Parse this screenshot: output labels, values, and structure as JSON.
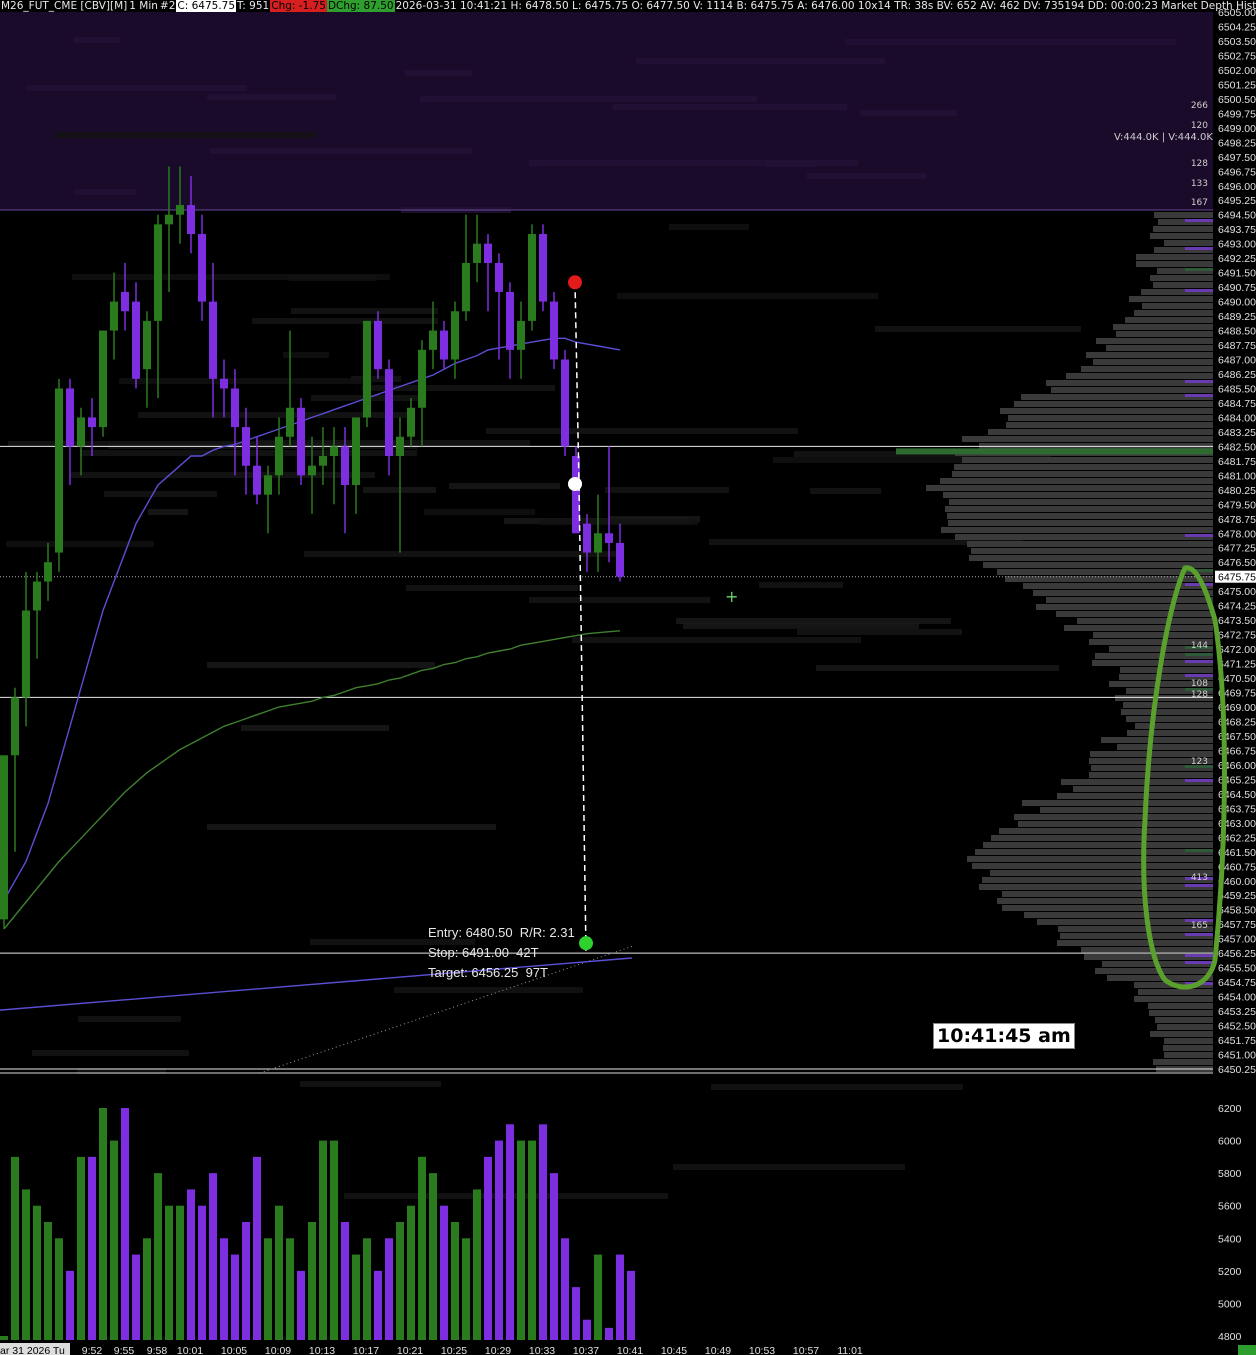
{
  "header": {
    "symbol": "M26_FUT_CME [CBV][M]",
    "interval": "1 Min",
    "chart_no": "#2",
    "close": "C: 6475.75",
    "ticks": "T: 951",
    "chg": "Chg: -1.75",
    "dchg": "DChg: 87.50",
    "rest": "2026-03-31 10:41:21 H: 6478.50 L: 6475.75 O: 6477.50 V: 1114 B: 6475.75 A: 6476.00 10x14 TR: 38s BV: 652 AV: 462 DV: 735194 DD: 00:00:23 Market Depth Historical G",
    "colors": {
      "chg_bg": "#d62020",
      "dchg_bg": "#2e9e2e",
      "close_bg": "#ffffff"
    }
  },
  "volume_readout": "V:444.0K | V:444.0K",
  "clock": "10:41:45 am",
  "trade": {
    "entry": "Entry: 6480.50  R/R: 2.31",
    "stop": "Stop: 6491.00  42T",
    "target": "Target: 6456.25  97T"
  },
  "price_axis": {
    "labels": [
      "6505.00",
      "6504.25",
      "6503.50",
      "6502.75",
      "6502.00",
      "6501.25",
      "6500.50",
      "6499.75",
      "6499.00",
      "6498.25",
      "6497.50",
      "6496.75",
      "6496.00",
      "6495.25",
      "6494.50",
      "6493.75",
      "6493.00",
      "6492.25",
      "6491.50",
      "6490.75",
      "6490.00",
      "6489.25",
      "6488.50",
      "6487.75",
      "6487.00",
      "6486.25",
      "6485.50",
      "6484.75",
      "6484.00",
      "6483.25",
      "6482.50",
      "6481.75",
      "6481.00",
      "6480.25",
      "6479.50",
      "6478.75",
      "6478.00",
      "6477.25",
      "6476.50",
      "6475.75",
      "6475.00",
      "6474.25",
      "6473.50",
      "6472.75",
      "6472.00",
      "6471.25",
      "6470.50",
      "6469.75",
      "6469.00",
      "6468.25",
      "6467.50",
      "6466.75",
      "6466.00",
      "6465.25",
      "6464.50",
      "6463.75",
      "6463.00",
      "6462.25",
      "6461.50",
      "6460.75",
      "6460.00",
      "6459.25",
      "6458.50",
      "6457.75",
      "6457.00",
      "6456.25",
      "6455.50",
      "6454.75",
      "6454.00",
      "6453.25",
      "6452.50",
      "6451.75",
      "6451.00",
      "6450.25"
    ],
    "current": "6475.75"
  },
  "volume_axis": {
    "labels": [
      "6200",
      "6000",
      "5800",
      "5600",
      "5400",
      "5200",
      "5000",
      "4800"
    ]
  },
  "time_axis": {
    "labels": [
      "ar 31 2026 Tu",
      "9:52",
      "9:55",
      "9:58",
      "10:01",
      "10:05",
      "10:09",
      "10:13",
      "10:17",
      "10:21",
      "10:25",
      "10:29",
      "10:33",
      "10:37",
      "10:41",
      "10:45",
      "10:49",
      "10:53",
      "10:57",
      "11:01"
    ]
  },
  "profile_labels": [
    "266",
    "120",
    "128",
    "133",
    "167",
    "144",
    "108",
    "128",
    "123",
    "413",
    "165"
  ],
  "chart_data": {
    "type": "candlestick",
    "title": "",
    "ylim": [
      6450.25,
      6505.0
    ],
    "volume_ylim": [
      4800,
      6200
    ],
    "colors": {
      "up": "#2a7a1e",
      "down": "#7c2ee0",
      "ma_fast": "#5b4fd6",
      "ma_slow": "#3f7f2f",
      "background": "#000000"
    },
    "candles": [
      {
        "o": 6458.0,
        "h": 6466.0,
        "l": 6457.5,
        "c": 6466.5
      },
      {
        "o": 6466.5,
        "h": 6470.0,
        "l": 6461.5,
        "c": 6469.5
      },
      {
        "o": 6469.5,
        "h": 6476.0,
        "l": 6468.0,
        "c": 6474.0
      },
      {
        "o": 6474.0,
        "h": 6476.0,
        "l": 6471.5,
        "c": 6475.5
      },
      {
        "o": 6475.5,
        "h": 6477.5,
        "l": 6474.5,
        "c": 6476.5
      },
      {
        "o": 6477.0,
        "h": 6486.0,
        "l": 6476.0,
        "c": 6485.5
      },
      {
        "o": 6485.5,
        "h": 6486.0,
        "l": 6480.5,
        "c": 6482.5
      },
      {
        "o": 6482.5,
        "h": 6484.5,
        "l": 6481.0,
        "c": 6484.0
      },
      {
        "o": 6484.0,
        "h": 6485.0,
        "l": 6482.0,
        "c": 6483.5
      },
      {
        "o": 6483.5,
        "h": 6488.0,
        "l": 6483.0,
        "c": 6488.5
      },
      {
        "o": 6488.5,
        "h": 6491.5,
        "l": 6487.0,
        "c": 6490.0
      },
      {
        "o": 6490.5,
        "h": 6492.0,
        "l": 6488.5,
        "c": 6489.5
      },
      {
        "o": 6490.0,
        "h": 6491.0,
        "l": 6485.5,
        "c": 6486.0
      },
      {
        "o": 6486.5,
        "h": 6489.5,
        "l": 6484.5,
        "c": 6489.0
      },
      {
        "o": 6489.0,
        "h": 6494.5,
        "l": 6485.0,
        "c": 6494.0
      },
      {
        "o": 6494.0,
        "h": 6497.0,
        "l": 6490.5,
        "c": 6494.5
      },
      {
        "o": 6494.5,
        "h": 6497.0,
        "l": 6493.0,
        "c": 6495.0
      },
      {
        "o": 6495.0,
        "h": 6496.5,
        "l": 6492.5,
        "c": 6493.5
      },
      {
        "o": 6493.5,
        "h": 6494.5,
        "l": 6489.0,
        "c": 6490.0
      },
      {
        "o": 6490.0,
        "h": 6492.0,
        "l": 6484.0,
        "c": 6486.0
      },
      {
        "o": 6486.0,
        "h": 6487.0,
        "l": 6484.0,
        "c": 6485.5
      },
      {
        "o": 6485.5,
        "h": 6486.5,
        "l": 6481.0,
        "c": 6483.5
      },
      {
        "o": 6483.5,
        "h": 6484.5,
        "l": 6480.0,
        "c": 6481.5
      },
      {
        "o": 6481.5,
        "h": 6483.0,
        "l": 6479.5,
        "c": 6480.0
      },
      {
        "o": 6480.0,
        "h": 6481.5,
        "l": 6478.0,
        "c": 6481.0
      },
      {
        "o": 6481.0,
        "h": 6484.0,
        "l": 6480.0,
        "c": 6483.0
      },
      {
        "o": 6483.0,
        "h": 6488.5,
        "l": 6482.5,
        "c": 6484.5
      },
      {
        "o": 6484.5,
        "h": 6485.0,
        "l": 6480.5,
        "c": 6481.0
      },
      {
        "o": 6481.0,
        "h": 6483.0,
        "l": 6479.0,
        "c": 6481.5
      },
      {
        "o": 6481.5,
        "h": 6483.5,
        "l": 6480.5,
        "c": 6482.0
      },
      {
        "o": 6482.0,
        "h": 6483.5,
        "l": 6479.5,
        "c": 6482.5
      },
      {
        "o": 6482.5,
        "h": 6483.5,
        "l": 6478.0,
        "c": 6480.5
      },
      {
        "o": 6480.5,
        "h": 6484.0,
        "l": 6479.0,
        "c": 6484.0
      },
      {
        "o": 6484.0,
        "h": 6489.0,
        "l": 6483.5,
        "c": 6489.0
      },
      {
        "o": 6489.0,
        "h": 6489.5,
        "l": 6486.0,
        "c": 6486.5
      },
      {
        "o": 6486.5,
        "h": 6487.0,
        "l": 6481.0,
        "c": 6482.0
      },
      {
        "o": 6482.0,
        "h": 6484.0,
        "l": 6477.0,
        "c": 6483.0
      },
      {
        "o": 6483.0,
        "h": 6485.0,
        "l": 6482.5,
        "c": 6484.5
      },
      {
        "o": 6484.5,
        "h": 6488.0,
        "l": 6482.5,
        "c": 6487.5
      },
      {
        "o": 6487.5,
        "h": 6490.0,
        "l": 6486.5,
        "c": 6488.5
      },
      {
        "o": 6488.5,
        "h": 6489.0,
        "l": 6486.5,
        "c": 6487.0
      },
      {
        "o": 6487.0,
        "h": 6490.0,
        "l": 6486.0,
        "c": 6489.5
      },
      {
        "o": 6489.5,
        "h": 6494.5,
        "l": 6489.0,
        "c": 6492.0
      },
      {
        "o": 6492.0,
        "h": 6494.5,
        "l": 6491.0,
        "c": 6493.0
      },
      {
        "o": 6493.0,
        "h": 6493.5,
        "l": 6489.5,
        "c": 6492.0
      },
      {
        "o": 6492.0,
        "h": 6492.5,
        "l": 6487.0,
        "c": 6490.5
      },
      {
        "o": 6490.5,
        "h": 6491.0,
        "l": 6486.0,
        "c": 6487.5
      },
      {
        "o": 6487.5,
        "h": 6490.0,
        "l": 6486.0,
        "c": 6489.0
      },
      {
        "o": 6489.0,
        "h": 6494.0,
        "l": 6488.5,
        "c": 6493.5
      },
      {
        "o": 6493.5,
        "h": 6494.0,
        "l": 6489.5,
        "c": 6490.0
      },
      {
        "o": 6490.0,
        "h": 6490.5,
        "l": 6486.5,
        "c": 6487.0
      },
      {
        "o": 6487.0,
        "h": 6487.5,
        "l": 6482.0,
        "c": 6482.5
      },
      {
        "o": 6482.0,
        "h": 6482.5,
        "l": 6478.0,
        "c": 6478.0
      },
      {
        "o": 6478.5,
        "h": 6479.0,
        "l": 6476.0,
        "c": 6477.0
      },
      {
        "o": 6477.0,
        "h": 6480.0,
        "l": 6476.0,
        "c": 6478.0
      },
      {
        "o": 6478.0,
        "h": 6482.5,
        "l": 6476.5,
        "c": 6477.5
      },
      {
        "o": 6477.5,
        "h": 6478.5,
        "l": 6475.5,
        "c": 6475.75
      }
    ],
    "candle_times_start": "9:48",
    "volume": [
      4800,
      5900,
      5700,
      5600,
      5500,
      5400,
      5200,
      5900,
      5900,
      6200,
      6000,
      6200,
      5300,
      5400,
      5800,
      5600,
      5600,
      5700,
      5600,
      5800,
      5400,
      5300,
      5500,
      5900,
      5400,
      5600,
      5400,
      5200,
      5500,
      6000,
      6000,
      5500,
      5300,
      5400,
      5200,
      5400,
      5500,
      5600,
      5900,
      5800,
      5600,
      5500,
      5400,
      5700,
      5900,
      6000,
      6100,
      6000,
      6000,
      6100,
      5800,
      5400,
      5100,
      4900,
      5300,
      4850,
      5300,
      5200
    ],
    "ma_fast": [
      6459,
      6460,
      6461,
      6462.5,
      6464,
      6466,
      6468,
      6470,
      6472,
      6474,
      6475.5,
      6477,
      6478.5,
      6479.5,
      6480.5,
      6481,
      6481.5,
      6482,
      6482,
      6482.3,
      6482.5,
      6482.6,
      6482.8,
      6483,
      6483.2,
      6483.4,
      6483.6,
      6483.8,
      6484,
      6484.2,
      6484.4,
      6484.6,
      6484.8,
      6485,
      6485.2,
      6485.4,
      6485.6,
      6485.8,
      6486,
      6486.2,
      6486.5,
      6486.8,
      6487,
      6487.2,
      6487.5,
      6487.6,
      6487.7,
      6487.8,
      6487.9,
      6488,
      6488.1,
      6488.1,
      6487.9,
      6487.8,
      6487.7,
      6487.6,
      6487.5
    ],
    "ma_slow": [
      6457.5,
      6458.2,
      6458.9,
      6459.6,
      6460.3,
      6461,
      6461.6,
      6462.2,
      6462.8,
      6463.4,
      6464,
      6464.6,
      6465.1,
      6465.6,
      6466,
      6466.4,
      6466.8,
      6467.1,
      6467.4,
      6467.7,
      6468,
      6468.2,
      6468.4,
      6468.6,
      6468.8,
      6469,
      6469.1,
      6469.2,
      6469.3,
      6469.5,
      6469.6,
      6469.8,
      6470,
      6470.1,
      6470.2,
      6470.4,
      6470.5,
      6470.7,
      6470.9,
      6471,
      6471.2,
      6471.3,
      6471.5,
      6471.6,
      6471.8,
      6471.9,
      6472,
      6472.2,
      6472.3,
      6472.4,
      6472.5,
      6472.6,
      6472.7,
      6472.8,
      6472.85,
      6472.9,
      6472.95
    ],
    "horizontal_lines": [
      6482.5,
      6469.5,
      6456.25,
      6450.25
    ],
    "dotted_line": 6475.75,
    "entry_marker": {
      "price": 6480.5
    },
    "stop_marker": {
      "price": 6491.0
    },
    "target_marker": {
      "price": 6456.25
    }
  }
}
